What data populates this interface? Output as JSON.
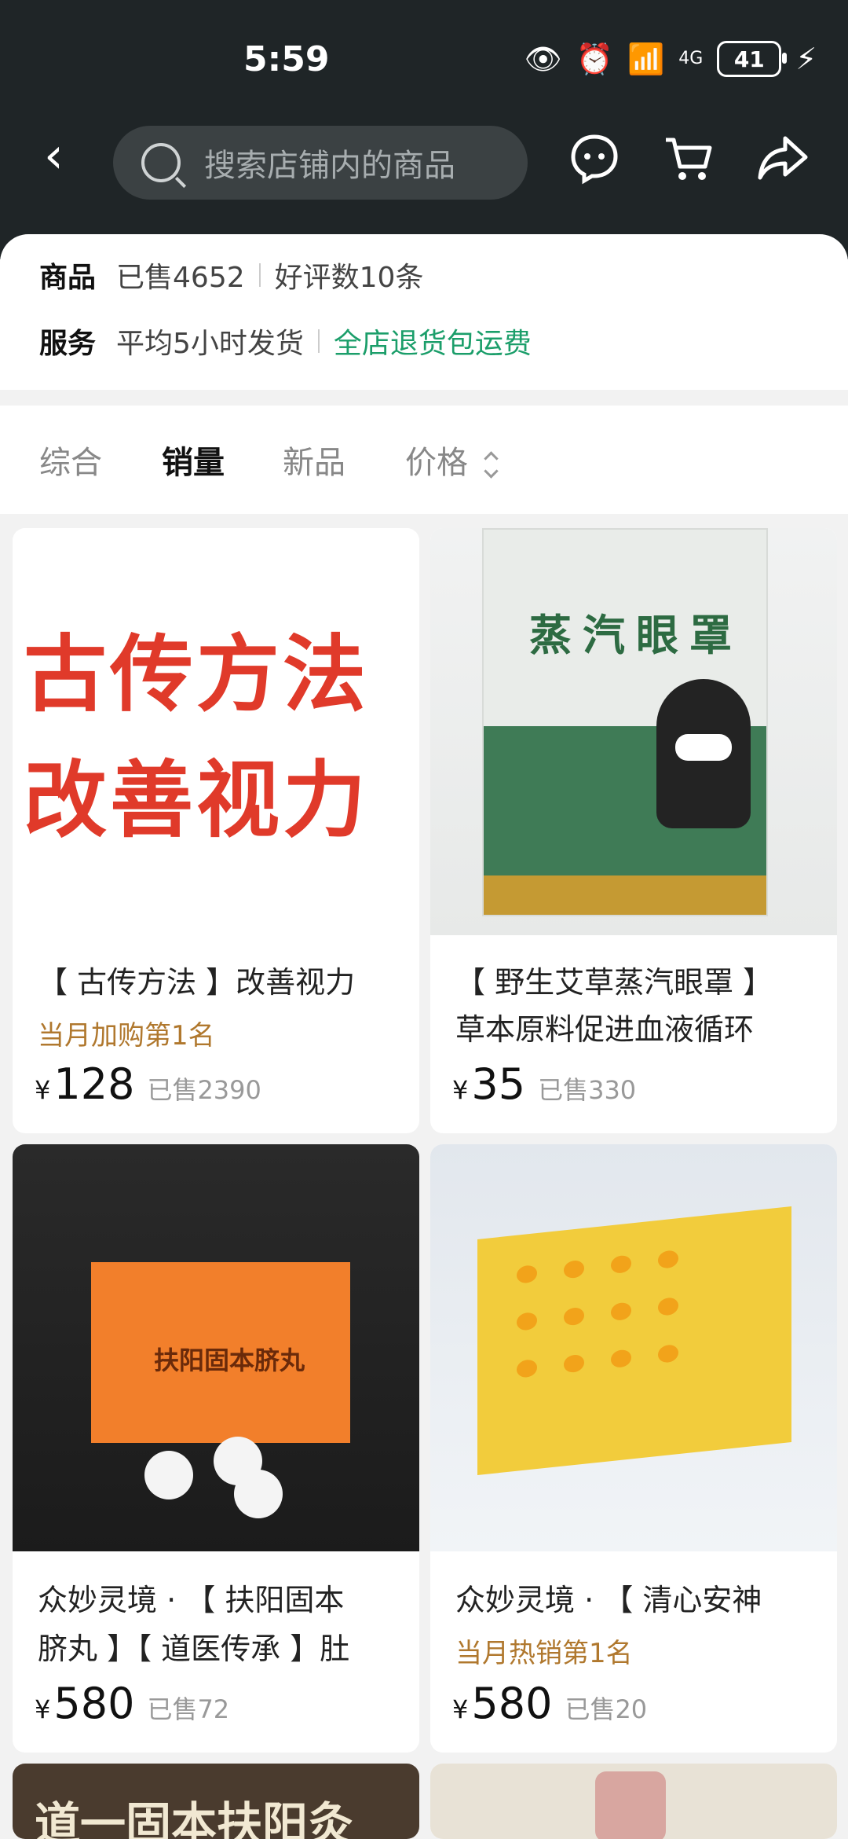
{
  "status": {
    "time": "5:59",
    "battery": "41",
    "network": "4G"
  },
  "header": {
    "search_placeholder": "搜索店铺内的商品",
    "icons": [
      "back-icon",
      "search-icon",
      "customer-service-icon",
      "cart-icon",
      "share-icon"
    ]
  },
  "shop_info": {
    "goods_label": "商品",
    "sold": "已售4652",
    "reviews": "好评数10条",
    "service_label": "服务",
    "ship_time": "平均5小时发货",
    "free_return": "全店退货包运费"
  },
  "sort_tabs": [
    "综合",
    "销量",
    "新品",
    "价格"
  ],
  "active_sort": "销量",
  "products": [
    {
      "image_text_line1": "古传方法",
      "image_text_line2": "改善视力",
      "title_line1": "【 古传方法 】改善视力",
      "title_line2": "",
      "tag": "当月加购第1名",
      "price": "128",
      "sold": "已售2390"
    },
    {
      "image_text": "蒸汽眼罩",
      "title_line1": "【 野生艾草蒸汽眼罩 】",
      "title_line2": "草本原料促进血液循环",
      "tag": "",
      "price": "35",
      "sold": "已售330"
    },
    {
      "image_text": "扶阳固本脐丸",
      "title_line1": "众妙灵境 · 【 扶阳固本",
      "title_line2": "脐丸 】【 道医传承 】肚",
      "tag": "",
      "price": "580",
      "sold": "已售72"
    },
    {
      "title_line1": "众妙灵境 · 【 清心安神",
      "title_line2": "",
      "tag": "当月热销第1名",
      "price": "580",
      "sold": "已售20"
    },
    {
      "image_text": "道一固本扶阳灸"
    }
  ],
  "currency": "¥"
}
